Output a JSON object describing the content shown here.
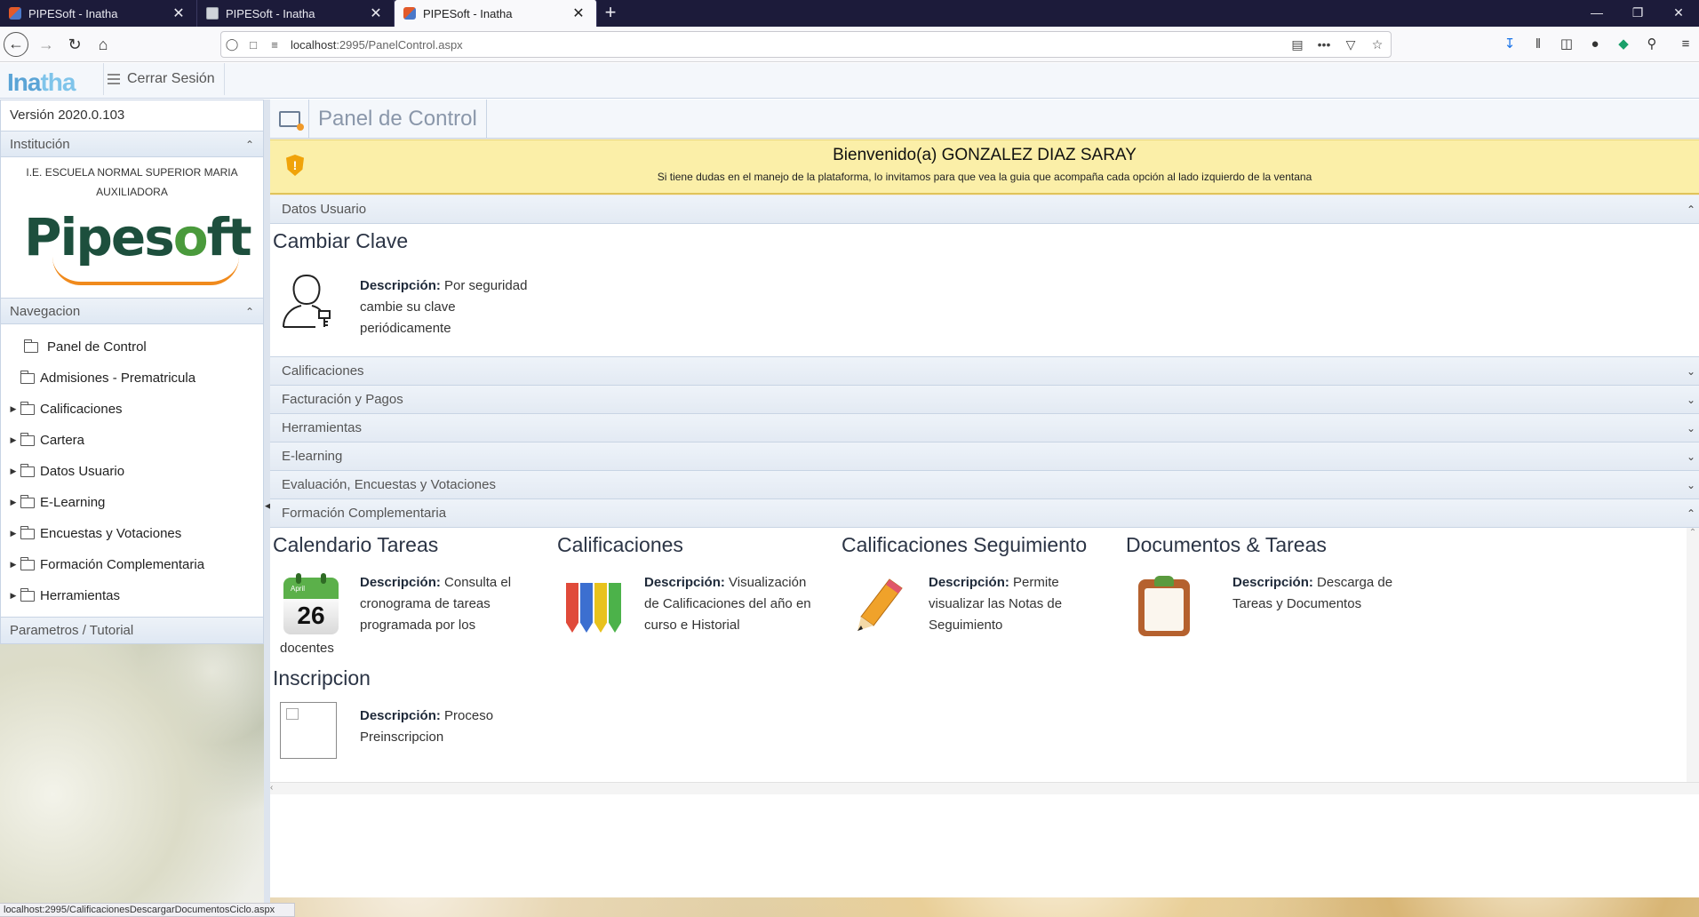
{
  "browser": {
    "tabs": [
      {
        "title": "PIPESoft - Inatha",
        "close": "✕"
      },
      {
        "title": "PIPESoft - Inatha",
        "close": "✕"
      },
      {
        "title": "PIPESoft - Inatha",
        "close": "✕"
      }
    ],
    "new_tab": "+",
    "url_host": "localhost",
    "url_path": ":2995/PanelControl.aspx",
    "status_url": "localhost:2995/CalificacionesDescargarDocumentosCiclo.aspx"
  },
  "app": {
    "logo_a": "Ina",
    "logo_b": "tha",
    "logout_label": "Cerrar Sesión"
  },
  "sidebar": {
    "version": "Versión 2020.0.103",
    "institution_header": "Institución",
    "institution_name": "I.E. ESCUELA NORMAL SUPERIOR MARIA AUXILIADORA",
    "logo_text_a": "Pipes",
    "logo_text_b": "o",
    "logo_text_c": "ft",
    "nav_header": "Navegacion",
    "items": [
      {
        "label": "Panel de Control",
        "expandable": false
      },
      {
        "label": "Admisiones - Prematricula",
        "expandable": false
      },
      {
        "label": "Calificaciones",
        "expandable": true
      },
      {
        "label": "Cartera",
        "expandable": true
      },
      {
        "label": "Datos Usuario",
        "expandable": true
      },
      {
        "label": "E-Learning",
        "expandable": true
      },
      {
        "label": "Encuestas y Votaciones",
        "expandable": true
      },
      {
        "label": "Formación Complementaria",
        "expandable": true
      },
      {
        "label": "Herramientas",
        "expandable": true
      }
    ],
    "footer": "Parametros / Tutorial"
  },
  "page": {
    "title": "Panel de Control",
    "welcome_title": "Bienvenido(a) GONZALEZ DIAZ SARAY",
    "welcome_text": "Si tiene dudas en el manejo de la plataforma, lo invitamos para que vea la guia que acompaña cada opción al lado izquierdo de la ventana"
  },
  "accordion": {
    "datos_usuario": "Datos Usuario",
    "calificaciones": "Calificaciones",
    "facturacion": "Facturación y Pagos",
    "herramientas": "Herramientas",
    "elearning": "E-learning",
    "evaluacion": "Evaluación, Encuestas y Votaciones",
    "formacion": "Formación Complementaria"
  },
  "cards": {
    "desc_label": "Descripción:",
    "cambiar_clave": {
      "title": "Cambiar Clave",
      "desc": " Por seguridad cambie su clave periódicamente"
    },
    "calendario": {
      "title": "Calendario Tareas",
      "desc": " Consulta el cronograma de tareas programada por los",
      "desc_tail": "docentes",
      "month": "April",
      "day": "26"
    },
    "calificaciones": {
      "title": "Calificaciones",
      "desc": " Visualización de Calificaciones del año en curso e Historial"
    },
    "seguimiento": {
      "title": "Calificaciones Seguimiento",
      "desc": " Permite visualizar las Notas de Seguimiento"
    },
    "documentos": {
      "title": "Documentos & Tareas",
      "desc": " Descarga de Tareas y Documentos"
    },
    "inscripcion": {
      "title": "Inscripcion",
      "desc": " Proceso Preinscripcion"
    }
  },
  "colors": {
    "chrome_dark": "#1c1b3a",
    "header_bg": "#f4f7fb",
    "welcome_bg": "#fbefa8",
    "pencil_colors": [
      "#e04a3a",
      "#3c6fd0",
      "#e8c21c",
      "#4cb24a"
    ]
  }
}
